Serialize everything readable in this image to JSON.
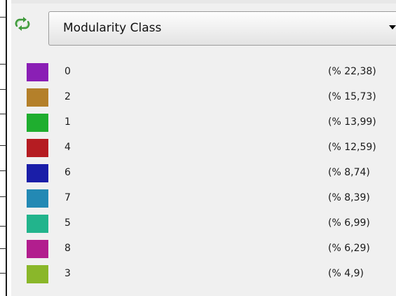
{
  "partition": {
    "icon": "partition-refresh-icon",
    "selected": "Modularity Class"
  },
  "legend": {
    "items": [
      {
        "label": "0",
        "percent": "(% 22,38)",
        "color": "#8a1fb5"
      },
      {
        "label": "2",
        "percent": "(% 15,73)",
        "color": "#b4802a"
      },
      {
        "label": "1",
        "percent": "(% 13,99)",
        "color": "#1fae2f"
      },
      {
        "label": "4",
        "percent": "(% 12,59)",
        "color": "#b51c22"
      },
      {
        "label": "6",
        "percent": "(% 8,74)",
        "color": "#1a1ea8"
      },
      {
        "label": "7",
        "percent": "(% 8,39)",
        "color": "#2389b4"
      },
      {
        "label": "5",
        "percent": "(% 6,99)",
        "color": "#22b48c"
      },
      {
        "label": "8",
        "percent": "(% 6,29)",
        "color": "#b21e8e"
      },
      {
        "label": "3",
        "percent": "(% 4,9)",
        "color": "#8ab72a"
      }
    ]
  }
}
